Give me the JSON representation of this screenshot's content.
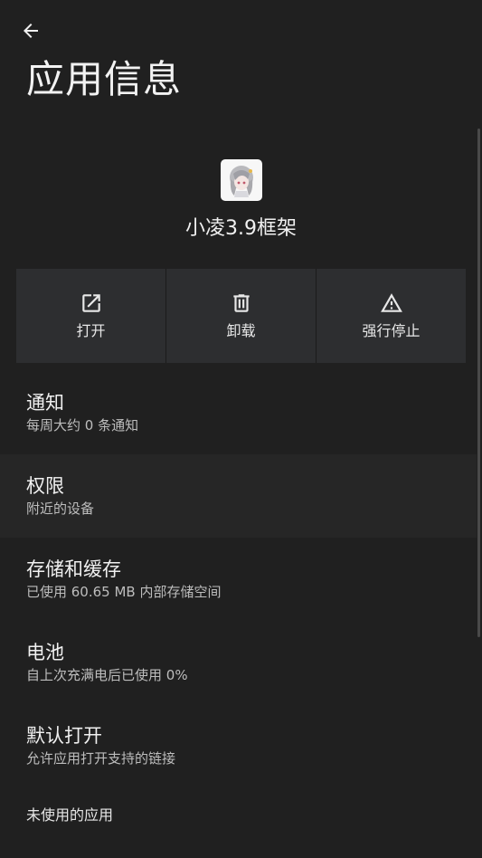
{
  "header": {
    "title": "应用信息"
  },
  "app": {
    "name": "小凌3.9框架"
  },
  "actions": [
    {
      "label": "打开",
      "icon": "open-in-new-icon"
    },
    {
      "label": "卸载",
      "icon": "trash-icon"
    },
    {
      "label": "强行停止",
      "icon": "warning-icon"
    }
  ],
  "settings": [
    {
      "title": "通知",
      "subtitle": "每周大约 0 条通知"
    },
    {
      "title": "权限",
      "subtitle": "附近的设备"
    },
    {
      "title": "存储和缓存",
      "subtitle": "已使用 60.65 MB 内部存储空间"
    },
    {
      "title": "电池",
      "subtitle": "自上次充满电后已使用 0%"
    },
    {
      "title": "默认打开",
      "subtitle": "允许应用打开支持的链接"
    }
  ],
  "section": {
    "unused_apps": "未使用的应用"
  },
  "colors": {
    "background": "#202020",
    "button_bg": "#2d2e30",
    "highlight_row": "#262626"
  }
}
